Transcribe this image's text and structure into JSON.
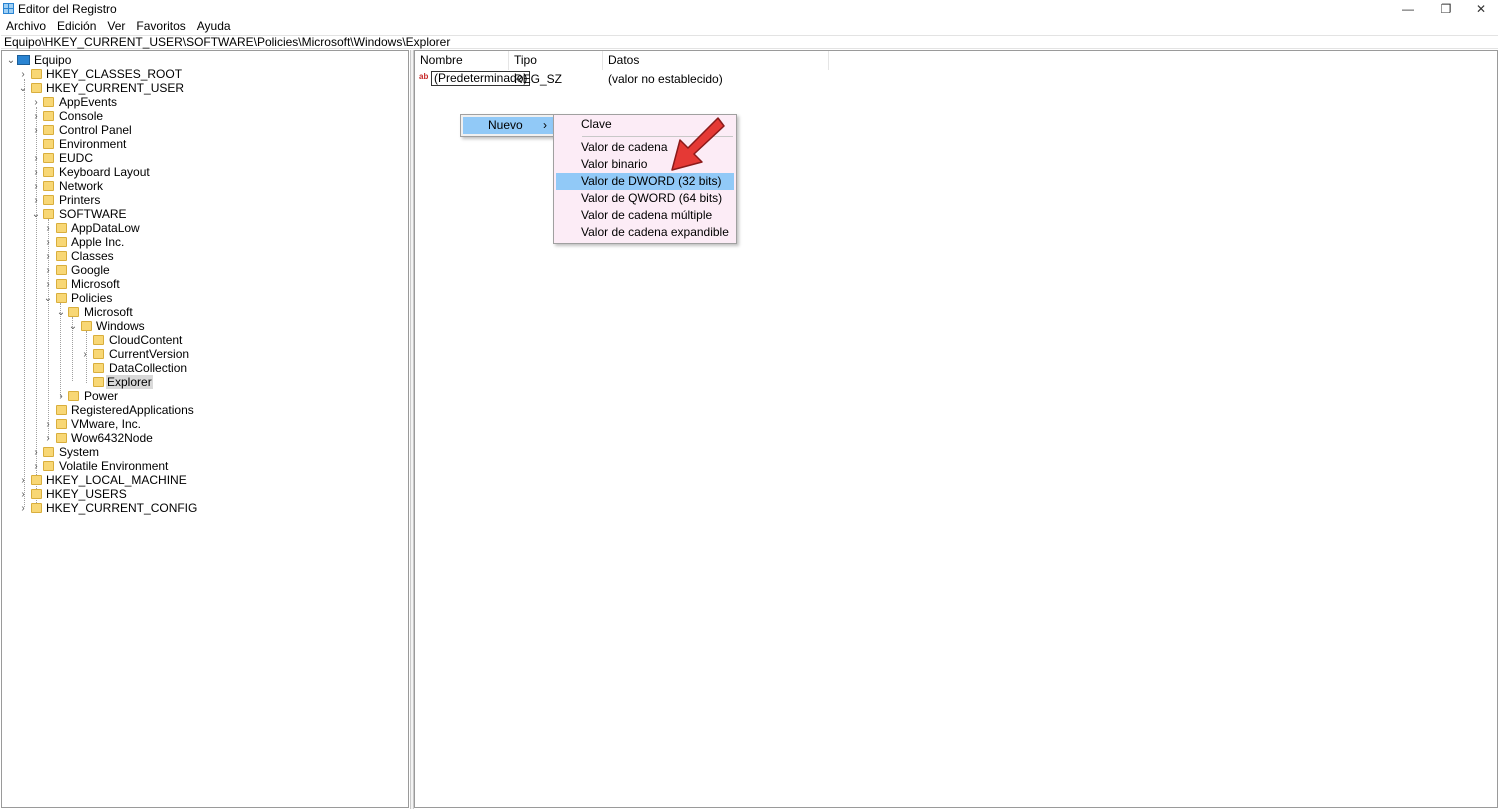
{
  "window": {
    "title": "Editor del Registro",
    "minimize": "—",
    "maximize": "❐",
    "close": "✕"
  },
  "menu": [
    "Archivo",
    "Edición",
    "Ver",
    "Favoritos",
    "Ayuda"
  ],
  "address": "Equipo\\HKEY_CURRENT_USER\\SOFTWARE\\Policies\\Microsoft\\Windows\\Explorer",
  "tree": {
    "root": "Equipo",
    "hkcr": "HKEY_CLASSES_ROOT",
    "hkcu": "HKEY_CURRENT_USER",
    "hkcu_children": [
      "AppEvents",
      "Console",
      "Control Panel",
      "Environment",
      "EUDC",
      "Keyboard Layout",
      "Network",
      "Printers",
      "SOFTWARE"
    ],
    "software_children": [
      "AppDataLow",
      "Apple Inc.",
      "Classes",
      "Google",
      "Microsoft",
      "Policies"
    ],
    "policies_children": [
      "Microsoft"
    ],
    "microsoft_children": [
      "Windows"
    ],
    "windows_children": [
      "CloudContent",
      "CurrentVersion",
      "DataCollection",
      "Explorer"
    ],
    "policies_after": [
      "Power"
    ],
    "software_after": [
      "RegisteredApplications",
      "VMware, Inc.",
      "Wow6432Node"
    ],
    "hkcu_after": [
      "System",
      "Volatile Environment"
    ],
    "roots_after": [
      "HKEY_LOCAL_MACHINE",
      "HKEY_USERS",
      "HKEY_CURRENT_CONFIG"
    ]
  },
  "list": {
    "columns": [
      "Nombre",
      "Tipo",
      "Datos"
    ],
    "rows": [
      {
        "icon": "ab",
        "name": "(Predeterminado)",
        "type": "REG_SZ",
        "data": "(valor no establecido)"
      }
    ]
  },
  "context_menu": {
    "item": "Nuevo",
    "arrow": "›"
  },
  "submenu": {
    "items": [
      "Clave",
      "Valor de cadena",
      "Valor binario",
      "Valor de DWORD (32 bits)",
      "Valor de QWORD (64 bits)",
      "Valor de cadena múltiple",
      "Valor de cadena expandible"
    ],
    "highlighted": "Valor de DWORD (32 bits)"
  },
  "colors": {
    "highlight": "#91c9f7",
    "submenu_bg": "#fcecf6",
    "arrow": "#e53935",
    "folder": "#f8d775"
  }
}
